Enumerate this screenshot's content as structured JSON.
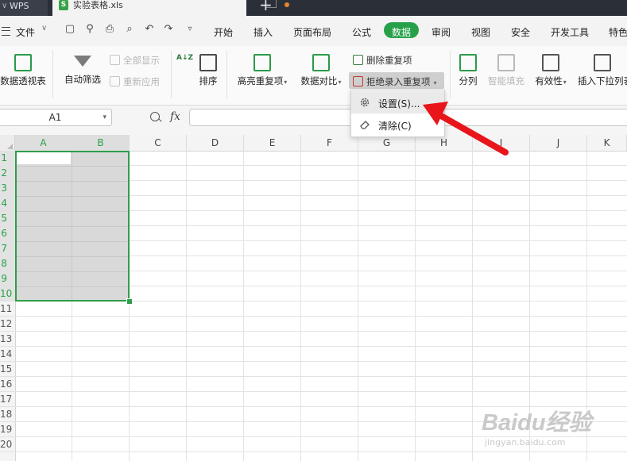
{
  "titlebar": {
    "app_tab": "WPS",
    "file_tab": "实验表格.xls",
    "add_tab_symbol": "+"
  },
  "menubar": {
    "file_menu": "文件",
    "items": [
      "开始",
      "插入",
      "页面布局",
      "公式",
      "数据",
      "审阅",
      "视图",
      "安全",
      "开发工具",
      "特色"
    ],
    "active_item": "数据",
    "quick_access_icons": [
      "save-icon",
      "format-painter-icon",
      "print-icon",
      "print-preview-icon",
      "undo-icon",
      "redo-icon",
      "customize-icon"
    ]
  },
  "ribbon": {
    "pivot_table": "数据透视表",
    "auto_filter": "自动筛选",
    "show_all": "全部显示",
    "reapply": "重新应用",
    "sort_az": "A↓Z",
    "sort": "排序",
    "highlight_dup": "高亮重复项",
    "compare": "数据对比",
    "remove_dup": "删除重复项",
    "reject_dup": "拒绝录入重复项",
    "split": "分列",
    "smart_fill": "智能填充",
    "validity": "有效性",
    "insert_dropdown": "插入下拉列表"
  },
  "dropdown_menu": {
    "items": [
      {
        "label": "设置(S)...",
        "icon": "gear-icon"
      },
      {
        "label": "清除(C)",
        "icon": "eraser-icon"
      }
    ]
  },
  "formula_bar": {
    "name_box": "A1",
    "fx_label": "fx",
    "formula_value": ""
  },
  "sheet": {
    "columns": [
      "A",
      "B",
      "C",
      "D",
      "E",
      "F",
      "G",
      "H",
      "I",
      "J",
      "K"
    ],
    "selected_columns": [
      "A",
      "B"
    ],
    "rows": [
      "1",
      "2",
      "3",
      "4",
      "5",
      "6",
      "7",
      "8",
      "9",
      "10",
      "11",
      "12",
      "13",
      "14",
      "15",
      "16",
      "17",
      "18",
      "19",
      "20"
    ],
    "selected_rows": [
      "1",
      "2",
      "3",
      "4",
      "5",
      "6",
      "7",
      "8",
      "9",
      "10"
    ],
    "selection": "A1:B10",
    "accent_color": "#27a149"
  },
  "watermark": {
    "main": "Baidu经验",
    "sub": "jingyan.baidu.com"
  },
  "annotation": {
    "arrow_color": "#e8151b"
  }
}
